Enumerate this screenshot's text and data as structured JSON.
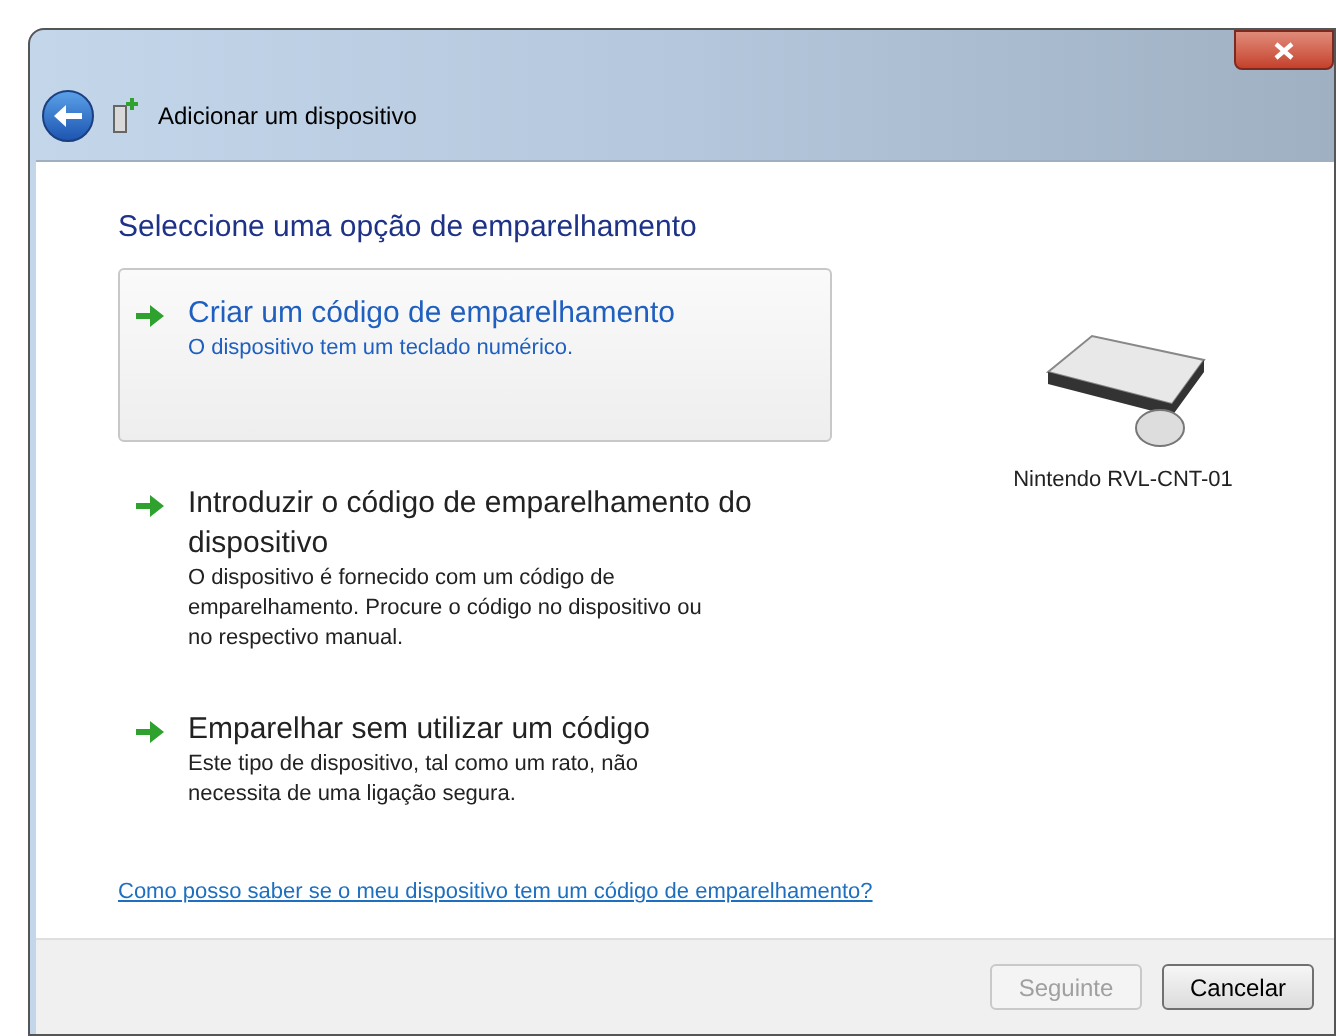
{
  "window": {
    "title": "Adicionar um dispositivo"
  },
  "heading": "Seleccione uma opção de emparelhamento",
  "options": [
    {
      "title": "Criar um código de emparelhamento",
      "description": "O dispositivo tem um teclado numérico.",
      "selected": true
    },
    {
      "title": "Introduzir o código de emparelhamento do dispositivo",
      "description": "O dispositivo é fornecido com um código de emparelhamento. Procure o código no dispositivo ou no respectivo manual.",
      "selected": false
    },
    {
      "title": "Emparelhar sem utilizar um código",
      "description": "Este tipo de dispositivo, tal como um rato, não necessita de uma ligação segura.",
      "selected": false
    }
  ],
  "device": {
    "name": "Nintendo RVL-CNT-01"
  },
  "help_link": "Como posso saber se o meu dispositivo tem um código de emparelhamento?",
  "buttons": [
    {
      "label": "Seguinte",
      "disabled": true
    },
    {
      "label": "Cancelar",
      "disabled": false
    }
  ]
}
